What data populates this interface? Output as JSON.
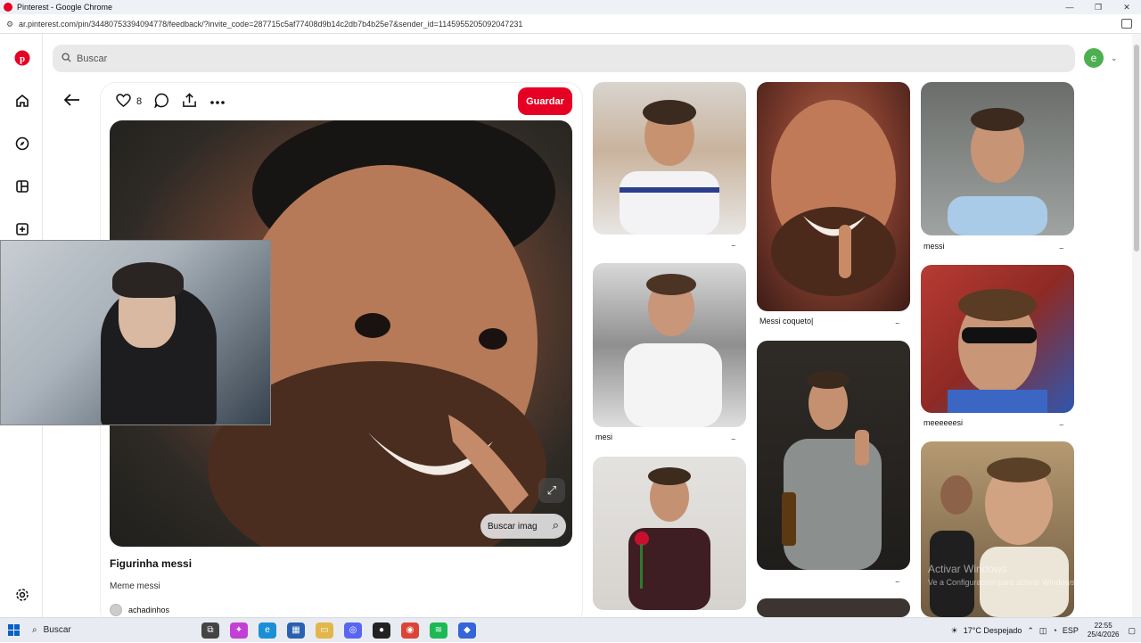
{
  "window": {
    "title": "Pinterest - Google Chrome",
    "controls": [
      "—",
      "❐",
      "✕"
    ]
  },
  "browser": {
    "url": "ar.pinterest.com/pin/34480753394094778/feedback/?invite_code=287715c5af77408d9b14c2db7b4b25e7&sender_id=1145955205092047231"
  },
  "search": {
    "placeholder": "Buscar"
  },
  "user": {
    "avatar_letter": "e"
  },
  "pin": {
    "like_count": "8",
    "save_label": "Guardar",
    "lens_label": "Buscar imag",
    "title": "Figurinha messi",
    "description": "Meme messi",
    "creator": "achadinhos"
  },
  "grid": {
    "labels": {
      "c1_2": "mesi",
      "c2_1": "Messi coqueto|",
      "c3_1": "messi",
      "c3_2": "meeeeeesi"
    },
    "more": "..."
  },
  "watermark": {
    "title": "Activar Windows",
    "subtitle": "Ve a Configuración para activar Windows."
  },
  "taskbar": {
    "search": "Buscar",
    "weather": "17°C  Despejado",
    "lang": "ESP",
    "time": "22:55",
    "date": "25/4/2026"
  },
  "colors": {
    "brand": "#e60023",
    "avatar": "#4caf50"
  }
}
